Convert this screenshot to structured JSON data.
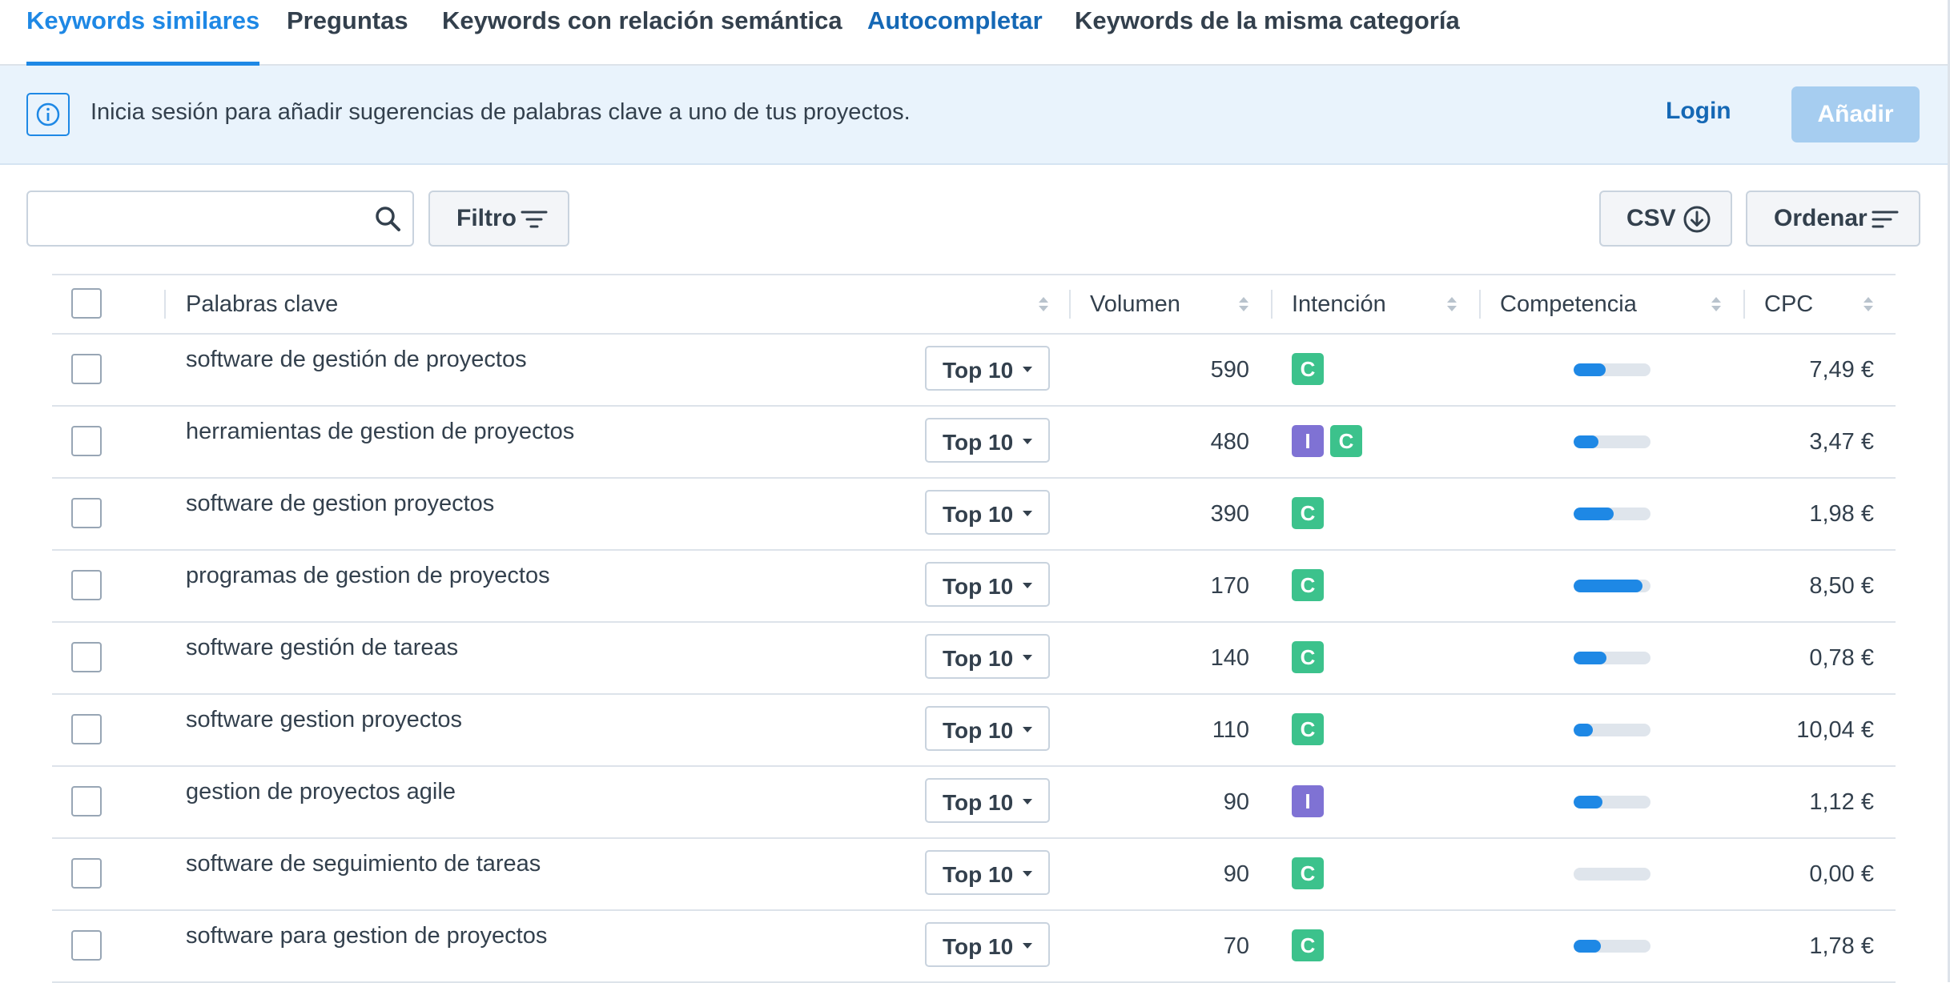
{
  "tabs": [
    {
      "label": "Keywords similares"
    },
    {
      "label": "Preguntas"
    },
    {
      "label": "Keywords con relación semántica"
    },
    {
      "label": "Autocompletar"
    },
    {
      "label": "Keywords de la misma categoría"
    }
  ],
  "banner": {
    "text": "Inicia sesión para añadir sugerencias de palabras clave a uno de tus proyectos.",
    "login_label": "Login",
    "add_label": "Añadir"
  },
  "toolbar": {
    "search_value": "",
    "filter_label": "Filtro",
    "csv_label": "CSV",
    "sort_label": "Ordenar"
  },
  "table": {
    "headers": {
      "keyword": "Palabras clave",
      "volume": "Volumen",
      "intent": "Intención",
      "competition": "Competencia",
      "cpc": "CPC"
    },
    "rows": [
      {
        "keyword": "software de gestión de proyectos",
        "rank": "Top 10",
        "volume": "590",
        "intents": [
          "C"
        ],
        "competition": 0.42,
        "cpc": "7,49 €"
      },
      {
        "keyword": "herramientas de gestion de proyectos",
        "rank": "Top 10",
        "volume": "480",
        "intents": [
          "I",
          "C"
        ],
        "competition": 0.32,
        "cpc": "3,47 €"
      },
      {
        "keyword": "software de gestion proyectos",
        "rank": "Top 10",
        "volume": "390",
        "intents": [
          "C"
        ],
        "competition": 0.52,
        "cpc": "1,98 €"
      },
      {
        "keyword": "programas de gestion de proyectos",
        "rank": "Top 10",
        "volume": "170",
        "intents": [
          "C"
        ],
        "competition": 0.9,
        "cpc": "8,50 €"
      },
      {
        "keyword": "software gestión de tareas",
        "rank": "Top 10",
        "volume": "140",
        "intents": [
          "C"
        ],
        "competition": 0.43,
        "cpc": "0,78 €"
      },
      {
        "keyword": "software gestion proyectos",
        "rank": "Top 10",
        "volume": "110",
        "intents": [
          "C"
        ],
        "competition": 0.25,
        "cpc": "10,04 €"
      },
      {
        "keyword": "gestion de proyectos agile",
        "rank": "Top 10",
        "volume": "90",
        "intents": [
          "I"
        ],
        "competition": 0.38,
        "cpc": "1,12 €"
      },
      {
        "keyword": "software de seguimiento de tareas",
        "rank": "Top 10",
        "volume": "90",
        "intents": [
          "C"
        ],
        "competition": 0.0,
        "cpc": "0,00 €"
      },
      {
        "keyword": "software para gestion de proyectos",
        "rank": "Top 10",
        "volume": "70",
        "intents": [
          "C"
        ],
        "competition": 0.35,
        "cpc": "1,78 €"
      }
    ]
  },
  "colors": {
    "accent": "#1e88e5",
    "intent_C": "#3cc28c",
    "intent_I": "#7f72d4"
  }
}
